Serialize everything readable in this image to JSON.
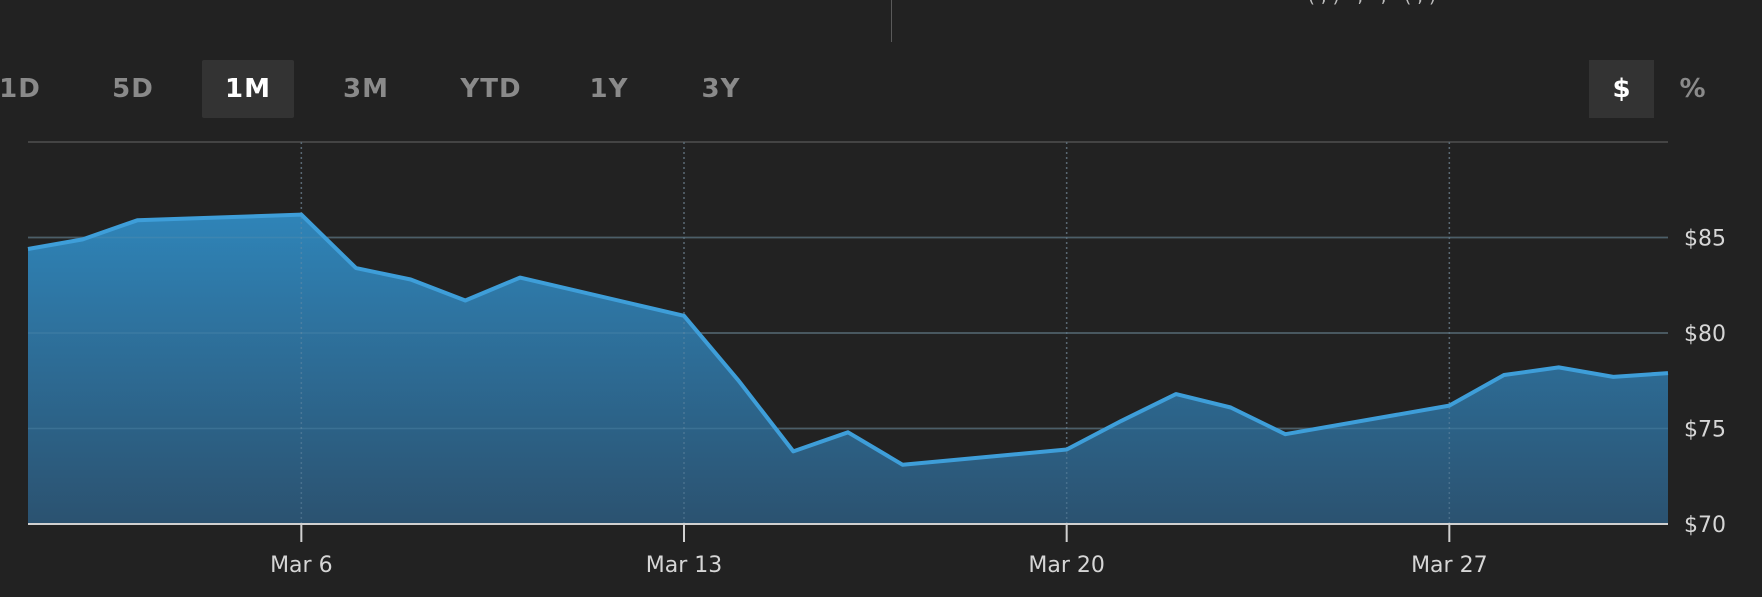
{
  "header": {
    "partial_text": "(,) , , (,)"
  },
  "range_tabs": [
    {
      "label": "1D",
      "active": false
    },
    {
      "label": "5D",
      "active": false
    },
    {
      "label": "1M",
      "active": true
    },
    {
      "label": "3M",
      "active": false
    },
    {
      "label": "YTD",
      "active": false
    },
    {
      "label": "1Y",
      "active": false
    },
    {
      "label": "3Y",
      "active": false
    }
  ],
  "unit_toggle": {
    "dollar_label": "$",
    "percent_label": "%",
    "selected": "$"
  },
  "colors": {
    "background": "#222222",
    "line": "#3e9ed9",
    "fill_top": "#2f84b8",
    "fill_bottom": "#2b5270",
    "grid": "#444444",
    "axis_text": "#d6d6d6"
  },
  "chart_data": {
    "type": "area",
    "title": "",
    "xlabel": "",
    "ylabel": "",
    "x": [
      "Mar 1",
      "Mar 2",
      "Mar 3",
      "Mar 6",
      "Mar 7",
      "Mar 8",
      "Mar 9",
      "Mar 10",
      "Mar 13",
      "Mar 14",
      "Mar 15",
      "Mar 16",
      "Mar 17",
      "Mar 20",
      "Mar 21",
      "Mar 22",
      "Mar 23",
      "Mar 24",
      "Mar 27",
      "Mar 28",
      "Mar 29",
      "Mar 30",
      "Mar 31"
    ],
    "series": [
      {
        "values": [
          84.4,
          84.9,
          85.9,
          86.2,
          83.4,
          82.8,
          81.7,
          82.9,
          80.9,
          77.5,
          73.8,
          74.8,
          73.1,
          73.9,
          75.4,
          76.8,
          76.1,
          74.7,
          76.2,
          77.8,
          78.2,
          77.7,
          77.9
        ]
      }
    ],
    "y_ticks": [
      "$85",
      "$80",
      "$75",
      "$70"
    ],
    "y_tick_values": [
      85,
      80,
      75,
      70
    ],
    "x_ticks": [
      "Mar 6",
      "Mar 13",
      "Mar 20",
      "Mar 27"
    ],
    "ylim": [
      70,
      90
    ],
    "grid": true,
    "y_axis_position": "right"
  }
}
